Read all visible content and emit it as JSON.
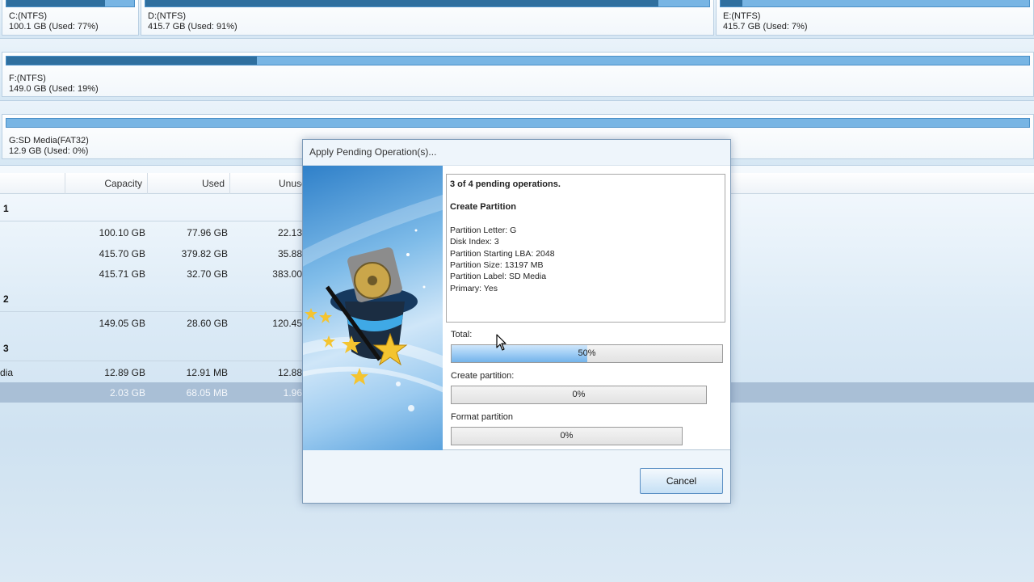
{
  "disk_map": {
    "row1": [
      {
        "name": "C:(NTFS)",
        "size": "100.1 GB (Used: 77%)",
        "used_fraction": 0.77
      },
      {
        "name": "D:(NTFS)",
        "size": "415.7 GB (Used: 91%)",
        "used_fraction": 0.91
      },
      {
        "name": "E:(NTFS)",
        "size": "415.7 GB (Used: 7%)",
        "used_fraction": 0.07
      }
    ],
    "row2": [
      {
        "name": "F:(NTFS)",
        "size": "149.0 GB (Used: 19%)",
        "used_fraction": 0.19
      }
    ],
    "row3": [
      {
        "name": "G:SD Media(FAT32)",
        "size": "12.9 GB (Used: 0%)",
        "used_fraction": 0.0
      }
    ]
  },
  "table": {
    "columns": [
      "Capacity",
      "Used",
      "Unuse"
    ],
    "groups": [
      {
        "label": "1",
        "rows": [
          {
            "name": "",
            "capacity": "100.10 GB",
            "used": "77.96 GB",
            "unused": "22.13"
          },
          {
            "name": "",
            "capacity": "415.70 GB",
            "used": "379.82 GB",
            "unused": "35.88"
          },
          {
            "name": "",
            "capacity": "415.71 GB",
            "used": "32.70 GB",
            "unused": "383.00"
          }
        ]
      },
      {
        "label": "2",
        "rows": [
          {
            "name": "",
            "capacity": "149.05 GB",
            "used": "28.60 GB",
            "unused": "120.45"
          }
        ]
      },
      {
        "label": "3",
        "rows": [
          {
            "name": "dia",
            "capacity": "12.89 GB",
            "used": "12.91 MB",
            "unused": "12.88"
          },
          {
            "name": "",
            "capacity": "2.03 GB",
            "used": "68.05 MB",
            "unused": "1.96"
          }
        ]
      }
    ]
  },
  "dialog": {
    "title": "Apply Pending Operation(s)...",
    "pending_header": "3 of 4 pending operations.",
    "operation": "Create Partition",
    "details": [
      "Partition Letter: G",
      "Disk Index: 3",
      "Partition Starting LBA: 2048",
      "Partition Size: 13197 MB",
      "Partition Label: SD Media",
      "Primary: Yes"
    ],
    "progress": {
      "total_label": "Total:",
      "total_text": "50%",
      "total_value": 0.5,
      "create_label": "Create partition:",
      "create_text": "0%",
      "create_value": 0,
      "format_label": "Format partition",
      "format_text": "0%",
      "format_value": 0
    },
    "cancel_label": "Cancel"
  },
  "colors": {
    "accent": "#4a90c8",
    "used_fill": "#2f6f9f",
    "selected_row": "#a9bfd6"
  }
}
